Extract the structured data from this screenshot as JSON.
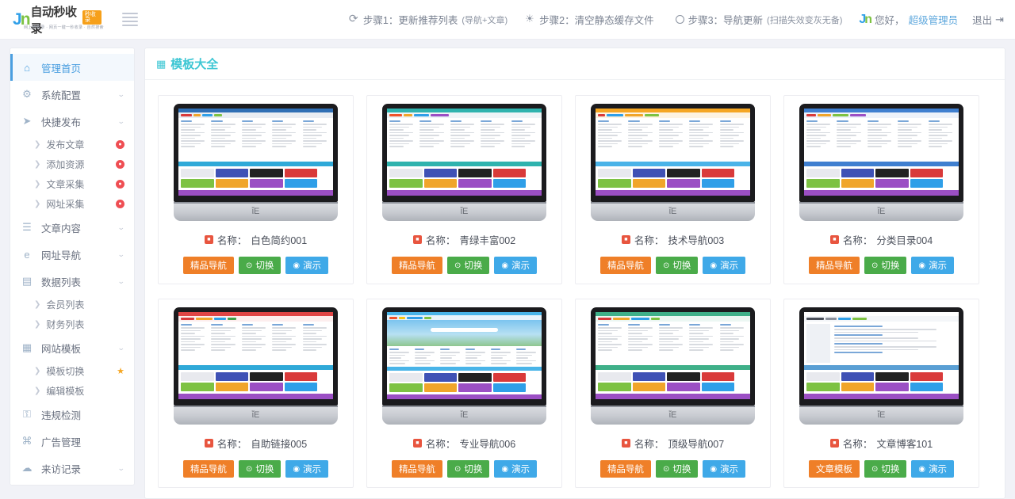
{
  "topbar": {
    "brand_j": "J",
    "brand_n": "n",
    "brand_text": "自动秒收录",
    "brand_badge": "秒收录",
    "brand_sub": "网上秒收录 · 网页一键一秒收录 · 自然搜索",
    "menu_toggle_icon": "hamburger-icon",
    "steps": [
      {
        "icon": "refresh-icon",
        "label": "步骤1：更新推荐列表",
        "note": "(导航+文章)"
      },
      {
        "icon": "spinner-icon",
        "label": "步骤2：清空静态缓存文件",
        "note": ""
      },
      {
        "icon": "circle-icon",
        "label": "步骤3：导航更新",
        "note": "(扫描失效变灰无备)"
      }
    ],
    "user": {
      "greet": "您好，",
      "name": "超级管理员"
    },
    "logout": "退出"
  },
  "sidebar": {
    "items": [
      {
        "icon": "home-icon",
        "glyph": "⌂",
        "label": "管理首页",
        "active": true,
        "caret": false,
        "children": []
      },
      {
        "icon": "gear-icon",
        "glyph": "⚙",
        "label": "系统配置",
        "active": false,
        "caret": true,
        "children": []
      },
      {
        "icon": "send-icon",
        "glyph": "➤",
        "label": "快捷发布",
        "active": false,
        "caret": true,
        "children": [
          {
            "label": "发布文章",
            "badge": "dot"
          },
          {
            "label": "添加资源",
            "badge": "dot"
          },
          {
            "label": "文章采集",
            "badge": "dot"
          },
          {
            "label": "网址采集",
            "badge": "dot"
          }
        ]
      },
      {
        "icon": "document-icon",
        "glyph": "὜E",
        "label": "文章内容",
        "active": false,
        "caret": true,
        "children": []
      },
      {
        "icon": "compass-icon",
        "glyph": "e",
        "label": "网址导航",
        "active": false,
        "caret": true,
        "children": []
      },
      {
        "icon": "list-icon",
        "glyph": "☰",
        "label": "数据列表",
        "active": false,
        "caret": true,
        "children": [
          {
            "label": "会员列表",
            "badge": ""
          },
          {
            "label": "财务列表",
            "badge": ""
          }
        ]
      },
      {
        "icon": "template-icon",
        "glyph": "▦",
        "label": "网站模板",
        "active": false,
        "caret": true,
        "children": [
          {
            "label": "模板切换",
            "badge": "star"
          },
          {
            "label": "编辑模板",
            "badge": ""
          }
        ]
      },
      {
        "icon": "lock-icon",
        "glyph": "ὑ2",
        "label": "违规检测",
        "active": false,
        "caret": false,
        "children": []
      },
      {
        "icon": "share-icon",
        "glyph": "⌘",
        "label": "广告管理",
        "active": false,
        "caret": false,
        "children": []
      },
      {
        "icon": "cloud-icon",
        "glyph": "☁",
        "label": "来访记录",
        "active": false,
        "caret": true,
        "children": []
      }
    ]
  },
  "main": {
    "panel_icon": "template-grid-icon",
    "panel_title": "模板大全",
    "name_prefix": "名称：",
    "cards": [
      {
        "name": "白色简约001",
        "theme": "white",
        "buttons": {
          "primary": "精品导航",
          "switch": "切换",
          "demo": "演示"
        }
      },
      {
        "name": "青绿丰富002",
        "theme": "teal",
        "buttons": {
          "primary": "精品导航",
          "switch": "切换",
          "demo": "演示"
        }
      },
      {
        "name": "技术导航003",
        "theme": "orange",
        "buttons": {
          "primary": "精品导航",
          "switch": "切换",
          "demo": "演示"
        }
      },
      {
        "name": "分类目录004",
        "theme": "blue",
        "buttons": {
          "primary": "精品导航",
          "switch": "切换",
          "demo": "演示"
        }
      },
      {
        "name": "自助链接005",
        "theme": "red",
        "buttons": {
          "primary": "精品导航",
          "switch": "切换",
          "demo": "演示"
        }
      },
      {
        "name": "专业导航006",
        "theme": "sky",
        "buttons": {
          "primary": "精品导航",
          "switch": "切换",
          "demo": "演示"
        }
      },
      {
        "name": "顶级导航007",
        "theme": "green",
        "buttons": {
          "primary": "精品导航",
          "switch": "切换",
          "demo": "演示"
        }
      },
      {
        "name": "文章博客101",
        "theme": "article",
        "buttons": {
          "primary": "文章模板",
          "switch": "切换",
          "demo": "演示"
        }
      }
    ]
  },
  "colors": {
    "accent_blue": "#4b9fe0",
    "title_teal": "#3fc7d4",
    "btn_orange": "#ef7f28",
    "btn_green": "#4aab49",
    "btn_blue": "#3fa9e8",
    "badge_red": "#ef4e53",
    "badge_star": "#f5a623",
    "page_bg": "#f1f2f7"
  }
}
